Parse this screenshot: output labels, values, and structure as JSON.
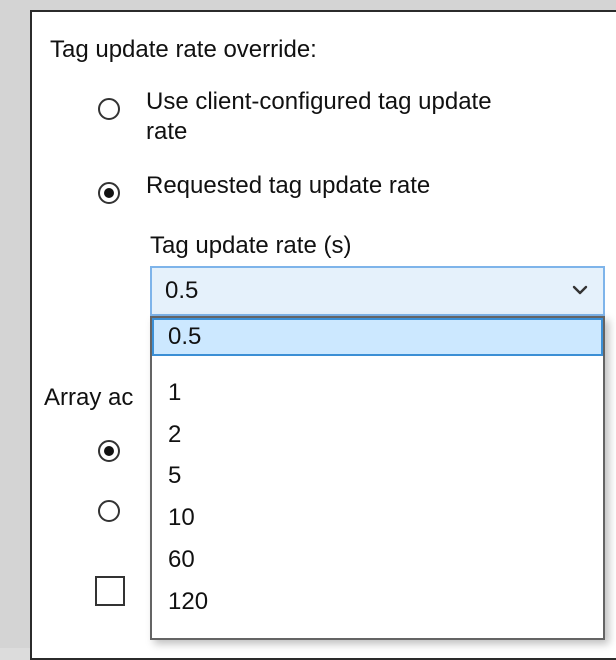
{
  "group": {
    "title": "Tag update rate override:",
    "options": [
      {
        "label_line1": "Use client-configured tag update",
        "label_line2": "rate",
        "checked": false
      },
      {
        "label_line1": "Requested tag update rate",
        "checked": true
      }
    ],
    "rate_label": "Tag update rate (s)",
    "combo_value": "0.5",
    "dropdown_options": [
      "0.5",
      "1",
      "2",
      "5",
      "10",
      "60",
      "120"
    ],
    "selected_option": "0.5"
  },
  "array_section": {
    "title_visible": "Array ac",
    "radio_1_checked": true,
    "radio_2_checked": false,
    "checkbox_checked": false
  },
  "colors": {
    "combo_bg": "#e5f1fb",
    "combo_border": "#7eb4ea",
    "option_highlight_bg": "#cce8ff",
    "option_highlight_border": "#3b8fd5"
  },
  "icons": {
    "dropdown": "chevron-down-icon"
  }
}
